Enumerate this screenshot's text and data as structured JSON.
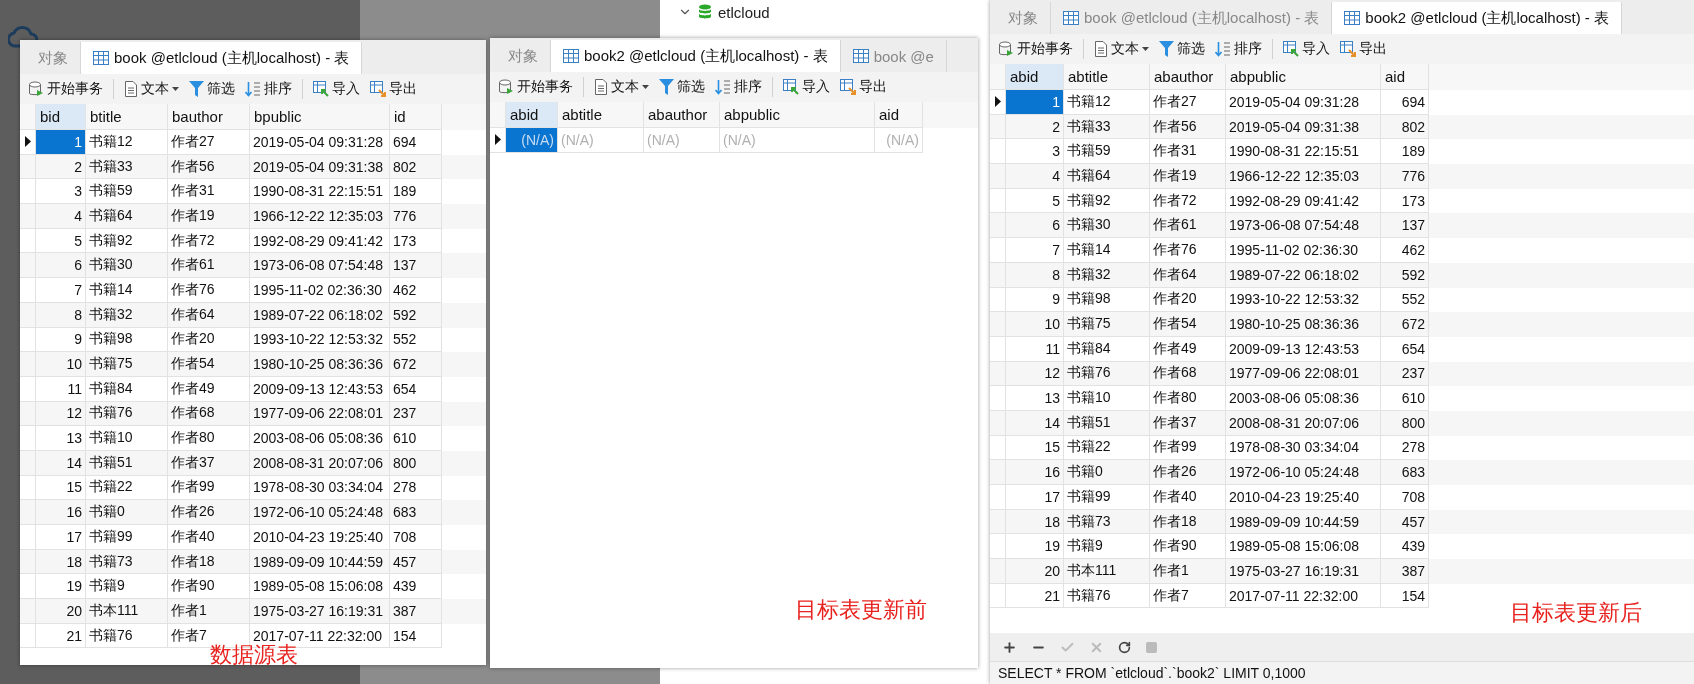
{
  "tree": {
    "item": {
      "label": "etlcloud",
      "expanded": true
    }
  },
  "windows": [
    {
      "tabs": [
        {
          "label": "对象",
          "selected": false
        },
        {
          "label": "book @etlcloud (主机localhost) - 表",
          "selected": true,
          "icon": true
        }
      ],
      "toolbar": [
        {
          "label": "开始事务",
          "kind": "transaction"
        },
        {
          "label": "文本",
          "kind": "text"
        },
        {
          "label": "筛选",
          "kind": "filter"
        },
        {
          "label": "排序",
          "kind": "sort"
        },
        {
          "label": "导入",
          "kind": "import"
        },
        {
          "label": "导出",
          "kind": "export"
        }
      ],
      "table": {
        "columns": [
          "bid",
          "btitle",
          "bauthor",
          "bpublic",
          "id"
        ],
        "rows": [
          {
            "kind": "data",
            "selected": true,
            "cells": [
              "1",
              "书籍12",
              "作者27",
              "2019-05-04 09:31:28",
              "694"
            ]
          },
          {
            "kind": "data",
            "selected": false,
            "cells": [
              "2",
              "书籍33",
              "作者56",
              "2019-05-04 09:31:38",
              "802"
            ]
          },
          {
            "kind": "data",
            "selected": false,
            "cells": [
              "3",
              "书籍59",
              "作者31",
              "1990-08-31 22:15:51",
              "189"
            ]
          },
          {
            "kind": "data",
            "selected": false,
            "cells": [
              "4",
              "书籍64",
              "作者19",
              "1966-12-22 12:35:03",
              "776"
            ]
          },
          {
            "kind": "data",
            "selected": false,
            "cells": [
              "5",
              "书籍92",
              "作者72",
              "1992-08-29 09:41:42",
              "173"
            ]
          },
          {
            "kind": "data",
            "selected": false,
            "cells": [
              "6",
              "书籍30",
              "作者61",
              "1973-06-08 07:54:48",
              "137"
            ]
          },
          {
            "kind": "data",
            "selected": false,
            "cells": [
              "7",
              "书籍14",
              "作者76",
              "1995-11-02 02:36:30",
              "462"
            ]
          },
          {
            "kind": "data",
            "selected": false,
            "cells": [
              "8",
              "书籍32",
              "作者64",
              "1989-07-22 06:18:02",
              "592"
            ]
          },
          {
            "kind": "data",
            "selected": false,
            "cells": [
              "9",
              "书籍98",
              "作者20",
              "1993-10-22 12:53:32",
              "552"
            ]
          },
          {
            "kind": "data",
            "selected": false,
            "cells": [
              "10",
              "书籍75",
              "作者54",
              "1980-10-25 08:36:36",
              "672"
            ]
          },
          {
            "kind": "data",
            "selected": false,
            "cells": [
              "11",
              "书籍84",
              "作者49",
              "2009-09-13 12:43:53",
              "654"
            ]
          },
          {
            "kind": "data",
            "selected": false,
            "cells": [
              "12",
              "书籍76",
              "作者68",
              "1977-09-06 22:08:01",
              "237"
            ]
          },
          {
            "kind": "data",
            "selected": false,
            "cells": [
              "13",
              "书籍10",
              "作者80",
              "2003-08-06 05:08:36",
              "610"
            ]
          },
          {
            "kind": "data",
            "selected": false,
            "cells": [
              "14",
              "书籍51",
              "作者37",
              "2008-08-31 20:07:06",
              "800"
            ]
          },
          {
            "kind": "data",
            "selected": false,
            "cells": [
              "15",
              "书籍22",
              "作者99",
              "1978-08-30 03:34:04",
              "278"
            ]
          },
          {
            "kind": "data",
            "selected": false,
            "cells": [
              "16",
              "书籍0",
              "作者26",
              "1972-06-10 05:24:48",
              "683"
            ]
          },
          {
            "kind": "data",
            "selected": false,
            "cells": [
              "17",
              "书籍99",
              "作者40",
              "2010-04-23 19:25:40",
              "708"
            ]
          },
          {
            "kind": "data",
            "selected": false,
            "cells": [
              "18",
              "书籍73",
              "作者18",
              "1989-09-09 10:44:59",
              "457"
            ]
          },
          {
            "kind": "data",
            "selected": false,
            "cells": [
              "19",
              "书籍9",
              "作者90",
              "1989-05-08 15:06:08",
              "439"
            ]
          },
          {
            "kind": "data",
            "selected": false,
            "cells": [
              "20",
              "书本111",
              "作者1",
              "1975-03-27 16:19:31",
              "387"
            ]
          },
          {
            "kind": "data",
            "selected": false,
            "cells": [
              "21",
              "书籍76",
              "作者7",
              "2017-07-11 22:32:00",
              "154"
            ]
          }
        ]
      },
      "annotation": "数据源表"
    },
    {
      "tabs": [
        {
          "label": "对象",
          "selected": false
        },
        {
          "label": "book2 @etlcloud (主机localhost) - 表",
          "selected": true,
          "icon": true
        },
        {
          "label": "book @e",
          "selected": false,
          "icon": true
        }
      ],
      "toolbar": [
        {
          "label": "开始事务",
          "kind": "transaction"
        },
        {
          "label": "文本",
          "kind": "text"
        },
        {
          "label": "筛选",
          "kind": "filter"
        },
        {
          "label": "排序",
          "kind": "sort"
        },
        {
          "label": "导入",
          "kind": "import"
        },
        {
          "label": "导出",
          "kind": "export"
        }
      ],
      "table": {
        "columns": [
          "abid",
          "abtitle",
          "abauthor",
          "abpublic",
          "aid"
        ],
        "rows": [
          {
            "kind": "null",
            "selected": true,
            "cells": [
              "(N/A)",
              "(N/A)",
              "(N/A)",
              "(N/A)",
              "(N/A)"
            ]
          }
        ]
      },
      "annotation": "目标表更新前"
    },
    {
      "tabs": [
        {
          "label": "对象",
          "selected": false
        },
        {
          "label": "book @etlcloud (主机localhost) - 表",
          "selected": false,
          "icon": true
        },
        {
          "label": "book2 @etlcloud (主机localhost) - 表",
          "selected": true,
          "icon": true
        }
      ],
      "toolbar": [
        {
          "label": "开始事务",
          "kind": "transaction"
        },
        {
          "label": "文本",
          "kind": "text"
        },
        {
          "label": "筛选",
          "kind": "filter"
        },
        {
          "label": "排序",
          "kind": "sort"
        },
        {
          "label": "导入",
          "kind": "import"
        },
        {
          "label": "导出",
          "kind": "export"
        }
      ],
      "table": {
        "columns": [
          "abid",
          "abtitle",
          "abauthor",
          "abpublic",
          "aid"
        ],
        "rows": [
          {
            "kind": "data",
            "selected": true,
            "cells": [
              "1",
              "书籍12",
              "作者27",
              "2019-05-04 09:31:28",
              "694"
            ]
          },
          {
            "kind": "data",
            "selected": false,
            "cells": [
              "2",
              "书籍33",
              "作者56",
              "2019-05-04 09:31:38",
              "802"
            ]
          },
          {
            "kind": "data",
            "selected": false,
            "cells": [
              "3",
              "书籍59",
              "作者31",
              "1990-08-31 22:15:51",
              "189"
            ]
          },
          {
            "kind": "data",
            "selected": false,
            "cells": [
              "4",
              "书籍64",
              "作者19",
              "1966-12-22 12:35:03",
              "776"
            ]
          },
          {
            "kind": "data",
            "selected": false,
            "cells": [
              "5",
              "书籍92",
              "作者72",
              "1992-08-29 09:41:42",
              "173"
            ]
          },
          {
            "kind": "data",
            "selected": false,
            "cells": [
              "6",
              "书籍30",
              "作者61",
              "1973-06-08 07:54:48",
              "137"
            ]
          },
          {
            "kind": "data",
            "selected": false,
            "cells": [
              "7",
              "书籍14",
              "作者76",
              "1995-11-02 02:36:30",
              "462"
            ]
          },
          {
            "kind": "data",
            "selected": false,
            "cells": [
              "8",
              "书籍32",
              "作者64",
              "1989-07-22 06:18:02",
              "592"
            ]
          },
          {
            "kind": "data",
            "selected": false,
            "cells": [
              "9",
              "书籍98",
              "作者20",
              "1993-10-22 12:53:32",
              "552"
            ]
          },
          {
            "kind": "data",
            "selected": false,
            "cells": [
              "10",
              "书籍75",
              "作者54",
              "1980-10-25 08:36:36",
              "672"
            ]
          },
          {
            "kind": "data",
            "selected": false,
            "cells": [
              "11",
              "书籍84",
              "作者49",
              "2009-09-13 12:43:53",
              "654"
            ]
          },
          {
            "kind": "data",
            "selected": false,
            "cells": [
              "12",
              "书籍76",
              "作者68",
              "1977-09-06 22:08:01",
              "237"
            ]
          },
          {
            "kind": "data",
            "selected": false,
            "cells": [
              "13",
              "书籍10",
              "作者80",
              "2003-08-06 05:08:36",
              "610"
            ]
          },
          {
            "kind": "data",
            "selected": false,
            "cells": [
              "14",
              "书籍51",
              "作者37",
              "2008-08-31 20:07:06",
              "800"
            ]
          },
          {
            "kind": "data",
            "selected": false,
            "cells": [
              "15",
              "书籍22",
              "作者99",
              "1978-08-30 03:34:04",
              "278"
            ]
          },
          {
            "kind": "data",
            "selected": false,
            "cells": [
              "16",
              "书籍0",
              "作者26",
              "1972-06-10 05:24:48",
              "683"
            ]
          },
          {
            "kind": "data",
            "selected": false,
            "cells": [
              "17",
              "书籍99",
              "作者40",
              "2010-04-23 19:25:40",
              "708"
            ]
          },
          {
            "kind": "data",
            "selected": false,
            "cells": [
              "18",
              "书籍73",
              "作者18",
              "1989-09-09 10:44:59",
              "457"
            ]
          },
          {
            "kind": "data",
            "selected": false,
            "cells": [
              "19",
              "书籍9",
              "作者90",
              "1989-05-08 15:06:08",
              "439"
            ]
          },
          {
            "kind": "data",
            "selected": false,
            "cells": [
              "20",
              "书本111",
              "作者1",
              "1975-03-27 16:19:31",
              "387"
            ]
          },
          {
            "kind": "data",
            "selected": false,
            "cells": [
              "21",
              "书籍76",
              "作者7",
              "2017-07-11 22:32:00",
              "154"
            ]
          }
        ]
      },
      "annotation": "目标表更新后",
      "status_bar": "SELECT * FROM `etlcloud`.`book2` LIMIT 0,1000"
    }
  ]
}
